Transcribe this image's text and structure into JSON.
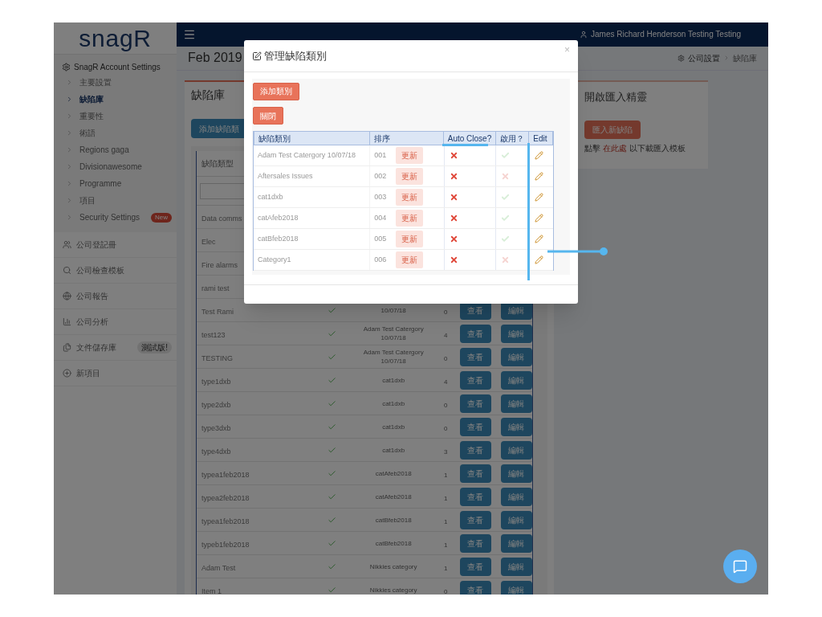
{
  "logo": "snagR",
  "header": {
    "user": "James Richard Henderson Testing Testing"
  },
  "sidebar": {
    "section": "SnagR Account Settings",
    "sub_items": [
      {
        "label": "主要設置",
        "selected": false
      },
      {
        "label": "缺陷庫",
        "selected": true
      },
      {
        "label": "重要性",
        "selected": false
      },
      {
        "label": "術語",
        "selected": false
      },
      {
        "label": "Regions gaga",
        "selected": false
      },
      {
        "label": "Divisionawesome",
        "selected": false
      },
      {
        "label": "Programme",
        "selected": false
      },
      {
        "label": "項目",
        "selected": false
      },
      {
        "label": "Security Settings",
        "selected": false,
        "badge": "New"
      }
    ],
    "items": [
      {
        "label": "公司登記冊"
      },
      {
        "label": "公司檢查模板"
      },
      {
        "label": "公司報告"
      },
      {
        "label": "公司分析"
      },
      {
        "label": "文件儲存庫",
        "badge": "測試版!"
      },
      {
        "label": "新項目"
      }
    ]
  },
  "page": {
    "title": "Feb 2019",
    "breadcrumb": [
      "公司設置",
      "缺陷庫"
    ]
  },
  "panel": {
    "title": "缺陷庫",
    "add_button": "添加缺陷類",
    "table": {
      "header": "缺陷類型",
      "rows": [
        {
          "name": "Data comms"
        },
        {
          "name": "Elec"
        },
        {
          "name": "Fire alarms"
        },
        {
          "name": "rami test"
        },
        {
          "name": "Test Rami",
          "active": true,
          "category": "10/07/18",
          "count": "0",
          "view": "查看",
          "edit": "編輯"
        },
        {
          "name": "test123",
          "active": true,
          "category": "Adam Test Catergory 10/07/18",
          "count": "4",
          "view": "查看",
          "edit": "編輯"
        },
        {
          "name": "TESTING",
          "active": true,
          "category": "Adam Test Catergory 10/07/18",
          "count": "0",
          "view": "查看",
          "edit": "編輯"
        },
        {
          "name": "type1dxb",
          "active": true,
          "category": "cat1dxb",
          "count": "4",
          "view": "查看",
          "edit": "編輯"
        },
        {
          "name": "type2dxb",
          "active": true,
          "category": "cat1dxb",
          "count": "0",
          "view": "查看",
          "edit": "編輯"
        },
        {
          "name": "type3dxb",
          "active": true,
          "category": "cat1dxb",
          "count": "0",
          "view": "查看",
          "edit": "編輯"
        },
        {
          "name": "type4dxb",
          "active": true,
          "category": "cat1dxb",
          "count": "3",
          "view": "查看",
          "edit": "編輯"
        },
        {
          "name": "typea1feb2018",
          "active": true,
          "category": "catAfeb2018",
          "count": "1",
          "view": "查看",
          "edit": "編輯"
        },
        {
          "name": "typea2feb2018",
          "active": true,
          "category": "catAfeb2018",
          "count": "1",
          "view": "查看",
          "edit": "編輯"
        },
        {
          "name": "typea1feb2018",
          "active": true,
          "category": "catBfeb2018",
          "count": "1",
          "view": "查看",
          "edit": "編輯"
        },
        {
          "name": "typeb1feb2018",
          "active": true,
          "category": "catBfeb2018",
          "count": "1",
          "view": "查看",
          "edit": "編輯"
        },
        {
          "name": "Adam Test",
          "active": true,
          "category": "Nikkies category",
          "count": "1",
          "view": "查看",
          "edit": "編輯"
        },
        {
          "name": "Item 1",
          "active": true,
          "category": "Nikkies category",
          "count": "0",
          "view": "查看",
          "edit": "編輯"
        }
      ]
    }
  },
  "import_panel": {
    "title": "開啟匯入精靈",
    "button": "匯入新缺陷",
    "hint_before": "點擊",
    "link": "在此處",
    "hint_after": "以下載匯入模板"
  },
  "modal": {
    "title": "管理缺陷類別",
    "close": "×",
    "add_button": "添加類別",
    "close_button": "關閉",
    "columns": [
      "缺陷類別",
      "排序",
      "Auto Close?",
      "啟用？",
      "Edit"
    ],
    "rows": [
      {
        "name": "Adam Test Catergory 10/07/18",
        "order": "001",
        "update": "更新",
        "auto_close": false,
        "enabled": true
      },
      {
        "name": "Aftersales Issues",
        "order": "002",
        "update": "更新",
        "auto_close": false,
        "enabled": false
      },
      {
        "name": "cat1dxb",
        "order": "003",
        "update": "更新",
        "auto_close": false,
        "enabled": true
      },
      {
        "name": "catAfeb2018",
        "order": "004",
        "update": "更新",
        "auto_close": false,
        "enabled": true
      },
      {
        "name": "catBfeb2018",
        "order": "005",
        "update": "更新",
        "auto_close": false,
        "enabled": true
      },
      {
        "name": "Category1",
        "order": "006",
        "update": "更新",
        "auto_close": false,
        "enabled": false
      }
    ]
  }
}
